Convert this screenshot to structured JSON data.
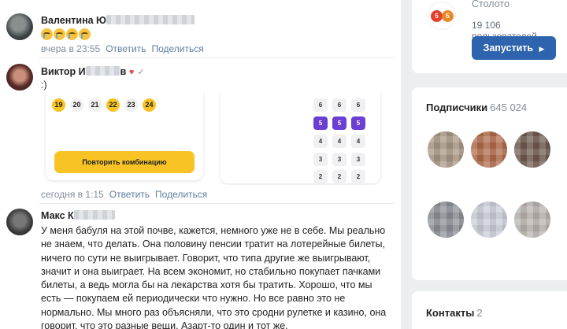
{
  "comments": [
    {
      "author": "Валентина Ю",
      "emoji": [
        "crying-face",
        "crying-face",
        "crying-face",
        "crying-face"
      ],
      "time": "вчера в 23:55",
      "reply_label": "Ответить",
      "share_label": "Поделиться"
    },
    {
      "author": "Виктор И",
      "author_rest": "в",
      "heart": "♥",
      "check": "✓",
      "text": ":)",
      "time": "сегодня в 1:15",
      "reply_label": "Ответить",
      "share_label": "Поделиться",
      "image": {
        "numbers": [
          "19",
          "20",
          "21",
          "22",
          "23",
          "24"
        ],
        "highlighted": [
          "19",
          "22",
          "24"
        ],
        "repeat_label": "Повторить комбинацию",
        "grid": [
          [
            "6",
            "6",
            "6"
          ],
          [
            "5",
            "5",
            "5"
          ],
          [
            "4",
            "4",
            "4"
          ],
          [
            "3",
            "3",
            "3"
          ],
          [
            "2",
            "2",
            "2"
          ]
        ]
      }
    },
    {
      "author": "Макс К",
      "text": "У меня бабуля на этой почве, кажется, немного уже не в себе. Мы реально не знаем, что делать. Она половину пенсии тратит на лотерейные билеты, ничего по сути не выигрывает. Говорит, что типа другие же выигрывают, значит и она выиграет. На всем экономит, но стабильно покупает пачками билеты, а ведь могла бы на лекарства хотя бы тратить. Хорошо, что мы есть — покупаем ей периодически что нужно. Но все равно это не нормально. Мы много раз объясняли, что это сродни рулетке и казино, она говорит, что это разные вещи. Азарт-то один и тот же."
    }
  ],
  "sidebar": {
    "app": {
      "name": "Столото",
      "users": "19 106 пользователей",
      "launch_label": "Запустить",
      "launch_arrow": "▶",
      "icon_balls": [
        "5",
        "5"
      ]
    },
    "subscribers": {
      "title": "Подписчики",
      "count": "645 024"
    },
    "contacts": {
      "title": "Контакты",
      "count": "2"
    }
  },
  "colors": {
    "accent": "#2d64ad",
    "link": "#5f7ea0",
    "lottery_yellow": "#f7c325",
    "lottery_purple": "#6b3fd4"
  }
}
